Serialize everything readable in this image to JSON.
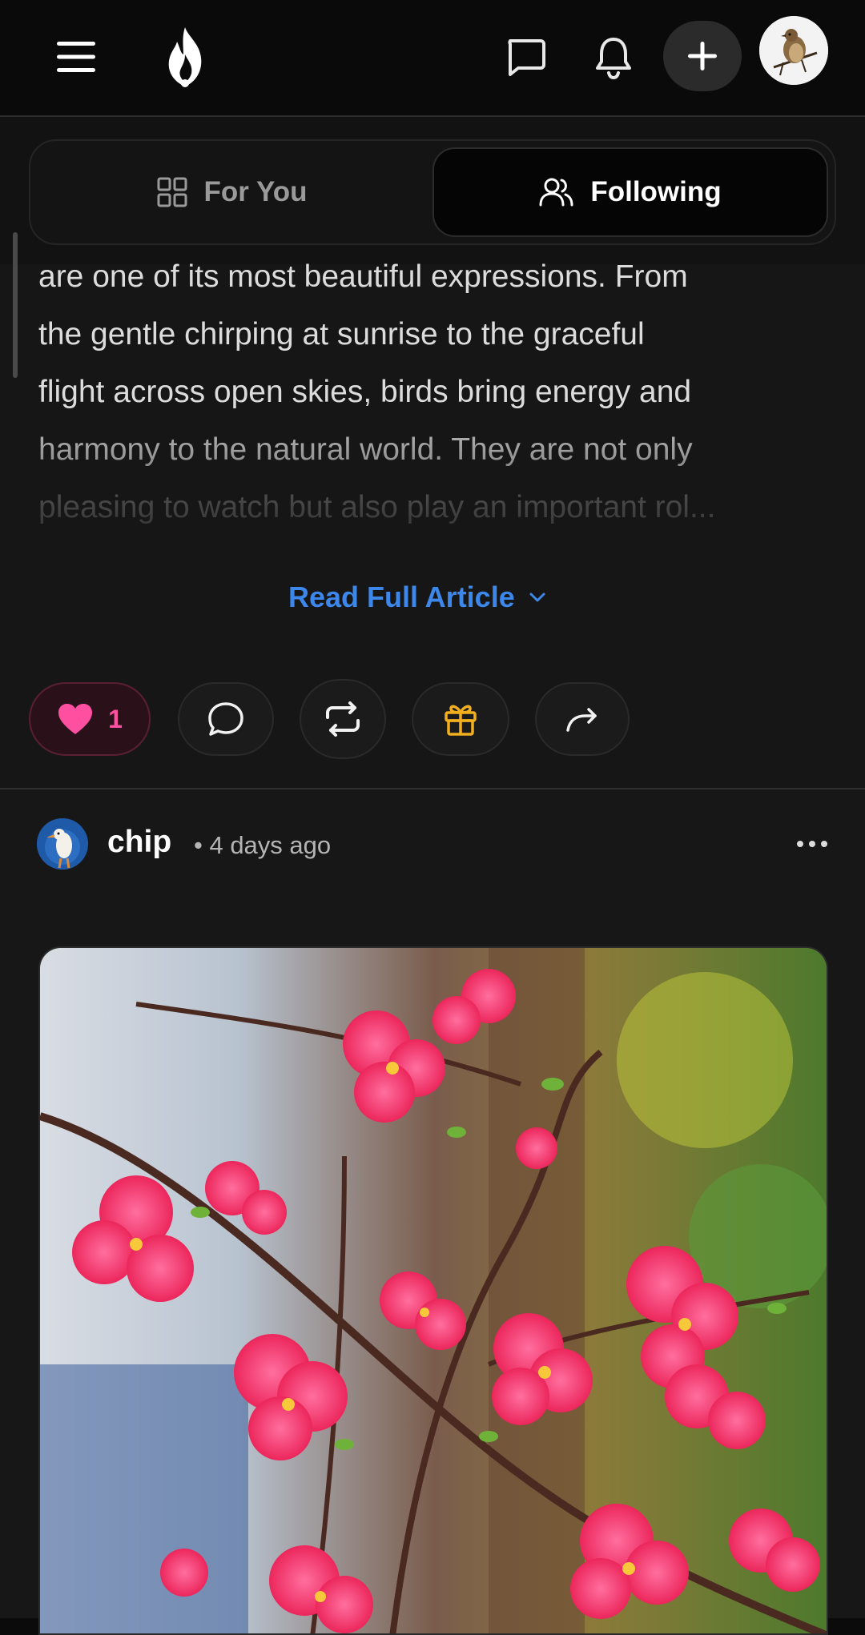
{
  "header": {
    "menu_icon": "hamburger-menu-icon",
    "logo_icon": "flame-icon",
    "chat_icon": "chat-bubble-icon",
    "notifications_icon": "bell-icon",
    "create_icon": "plus-icon",
    "avatar_icon": "bird-avatar"
  },
  "tabs": [
    {
      "label": "For You",
      "icon": "grid-icon",
      "active": false
    },
    {
      "label": "Following",
      "icon": "users-icon",
      "active": true
    }
  ],
  "post1": {
    "article_lines": [
      "are one of its most beautiful expressions. From",
      "the gentle chirping at sunrise to the graceful",
      "flight across open skies, birds bring energy and",
      "harmony to the natural world. They are not only",
      "pleasing to watch but also play an important rol..."
    ],
    "read_more_label": "Read Full Article",
    "likes_count": "1",
    "actions": [
      "heart-icon",
      "comment-icon",
      "repost-icon",
      "gift-icon",
      "share-icon"
    ]
  },
  "post2": {
    "author": "chip",
    "time": "• 4 days ago",
    "more_icon": "more-dots-icon",
    "image_icon": "pink-blossom-photo"
  },
  "colors": {
    "accent_blue": "#3d87ea",
    "like_pink": "#ff4fa0",
    "gift_gold": "#f2b01e",
    "background": "#161616"
  }
}
